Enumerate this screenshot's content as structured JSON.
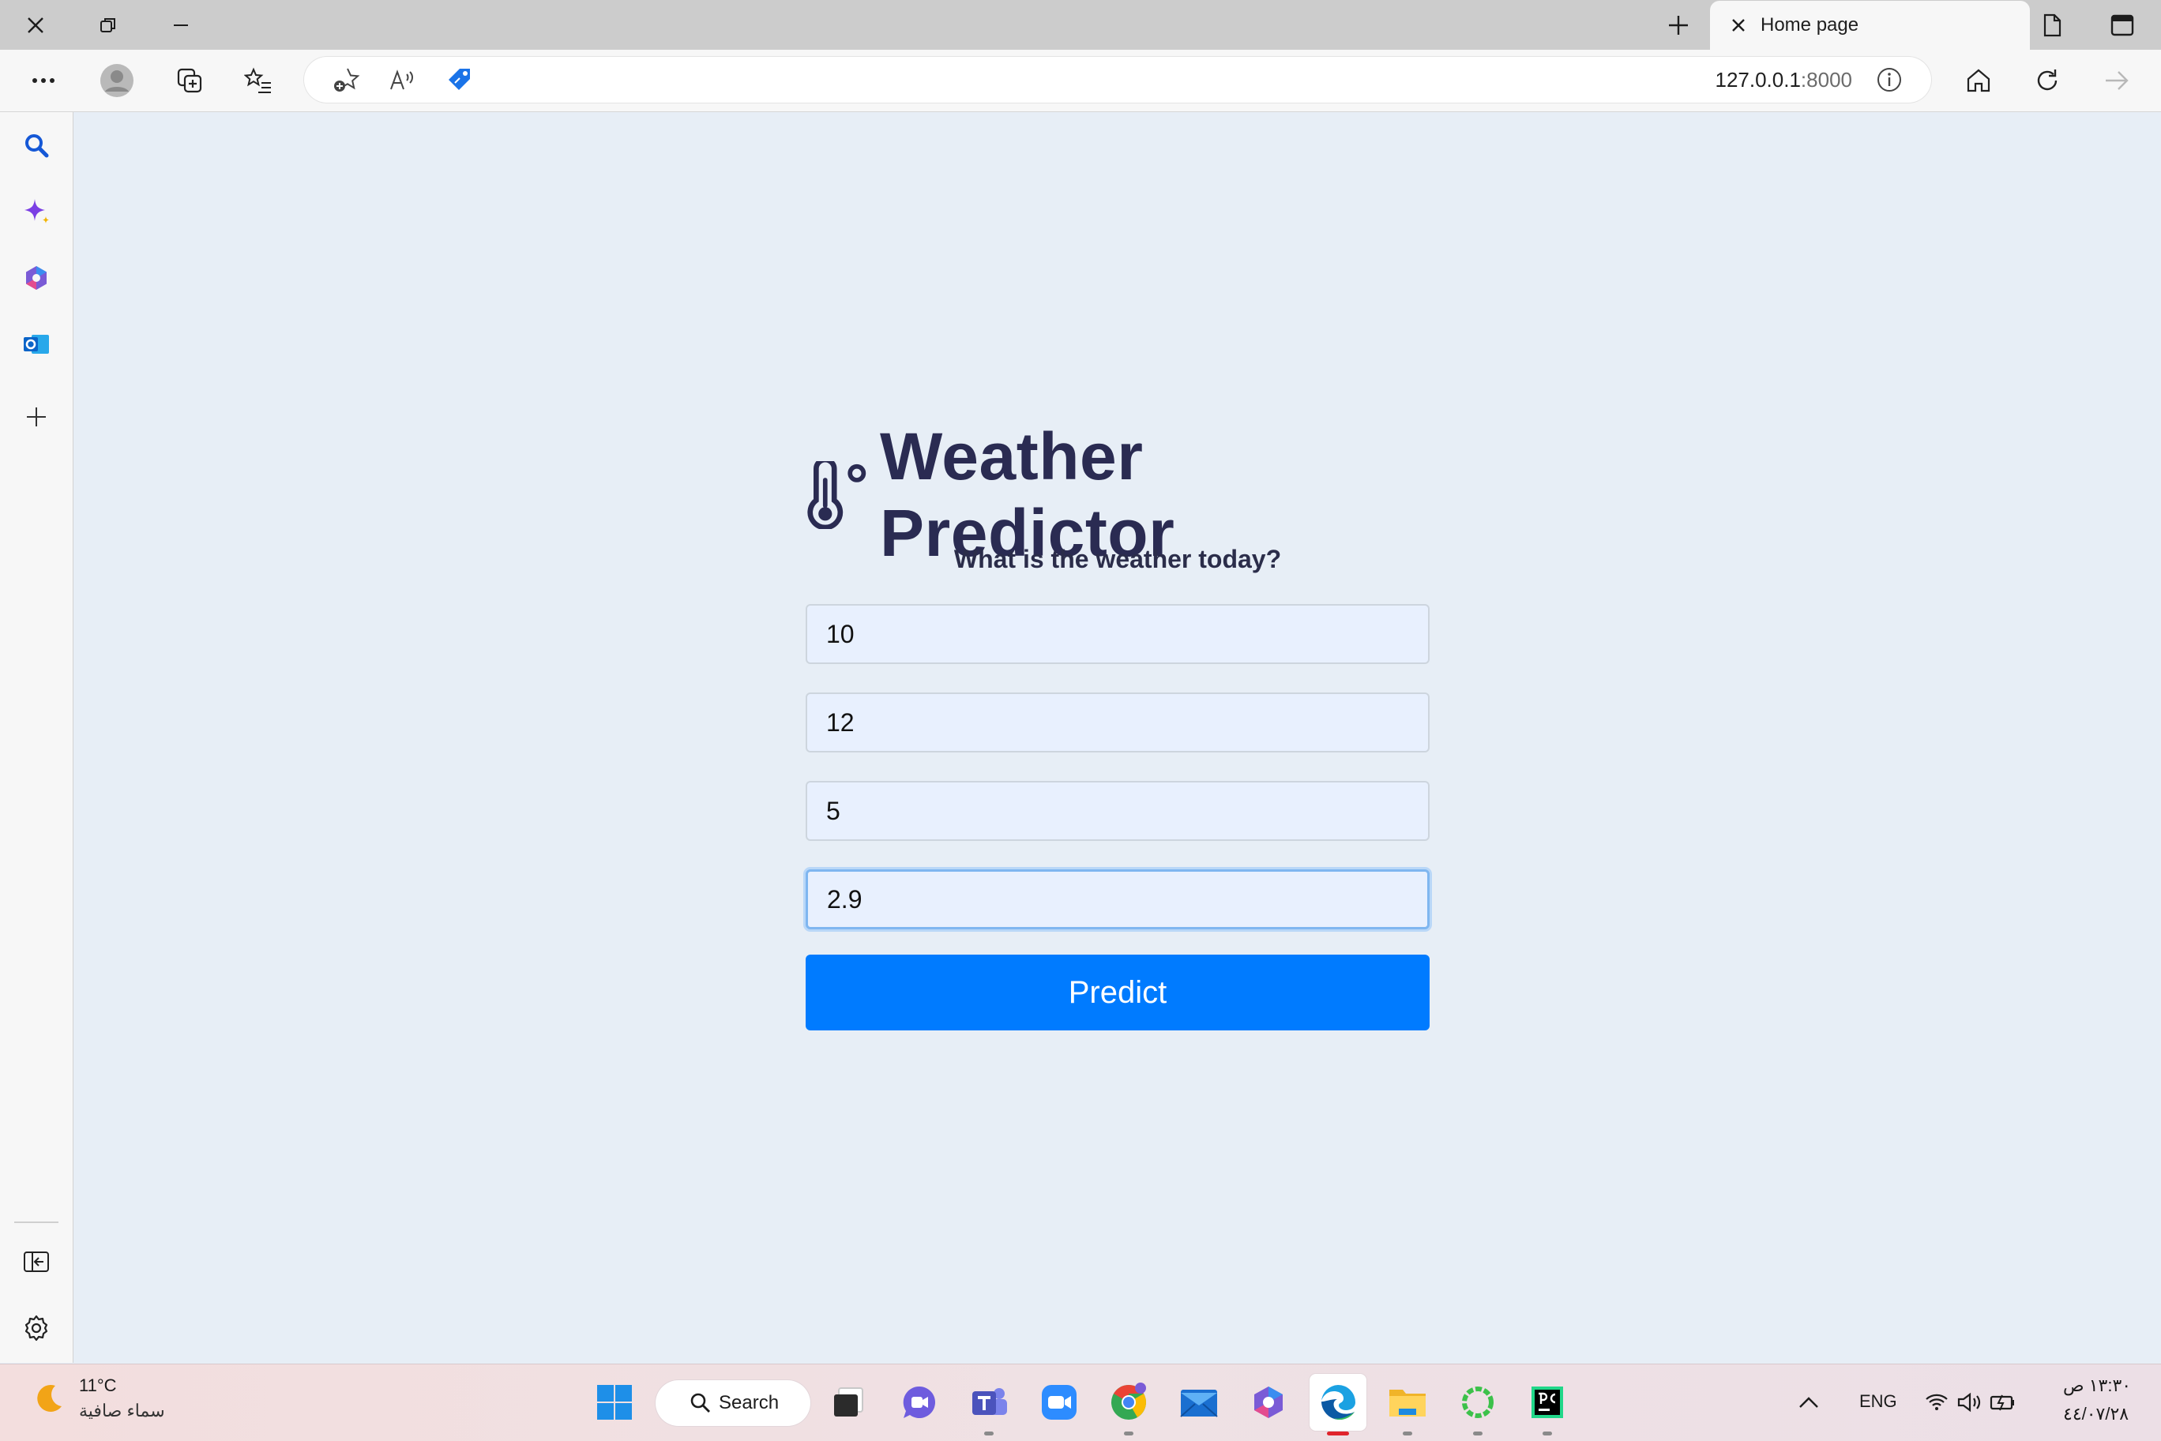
{
  "browser": {
    "tab_title": "Home page",
    "url_host": "127.0.0.1",
    "url_port": ":8000"
  },
  "page": {
    "title": "Weather Predictor",
    "subtitle": "What is the weather today?",
    "inputs": [
      {
        "value": "10"
      },
      {
        "value": "12"
      },
      {
        "value": "5"
      },
      {
        "value": "2.9"
      }
    ],
    "button_label": "Predict",
    "colors": {
      "accent": "#007bff",
      "title": "#2a2b52",
      "background": "#e7eef6",
      "input_bg": "#e8f0fe"
    }
  },
  "taskbar": {
    "weather_temp": "11°C",
    "weather_desc": "سماء صافية",
    "search_label": "Search",
    "language": "ENG",
    "time": "١٣:٣٠ ص",
    "date": "٤٤/٠٧/٢٨"
  }
}
